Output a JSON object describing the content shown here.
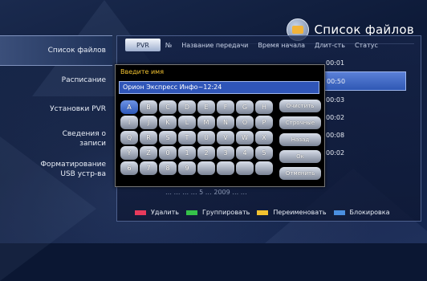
{
  "header": {
    "title": "Список файлов"
  },
  "menu": [
    {
      "label": "Список файлов",
      "active": true
    },
    {
      "label": "Расписание"
    },
    {
      "label": "Установки PVR"
    },
    {
      "label": "Сведения о\nзаписи"
    },
    {
      "label": "Форматирование\nUSB устр-ва"
    }
  ],
  "tabs": [
    "PVR",
    "№",
    "Название передачи",
    "Время начала",
    "Длит-сть",
    "Статус"
  ],
  "durations": [
    "00:01",
    "00:50",
    "00:03",
    "00:02",
    "00:08",
    "00:02"
  ],
  "ghost_row": "…  …  …  … 5 … 2009 … …",
  "legend": [
    {
      "color": "#e63a5c",
      "label": "Удалить"
    },
    {
      "color": "#35c24a",
      "label": "Группировать"
    },
    {
      "color": "#f2c230",
      "label": "Переименовать"
    },
    {
      "color": "#4a8fe0",
      "label": "Блокировка"
    }
  ],
  "dialog": {
    "title": "Введите имя",
    "value": "Орион Экспресс Инфо~12:24",
    "keys": [
      "A",
      "B",
      "C",
      "D",
      "E",
      "F",
      "G",
      "H",
      "I",
      "J",
      "K",
      "L",
      "M",
      "N",
      "O",
      "P",
      "Q",
      "R",
      "S",
      "T",
      "U",
      "V",
      "W",
      "X",
      "Y",
      "Z",
      "0",
      "1",
      "2",
      "3",
      "4",
      "5",
      "6",
      "7",
      "8",
      "9",
      "",
      "",
      "",
      ""
    ],
    "actions": [
      "Очистить",
      "Строчные",
      "Назад",
      "Ок",
      "Отменить"
    ]
  }
}
